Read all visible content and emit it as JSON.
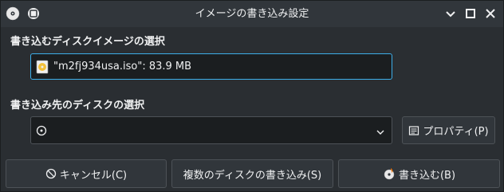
{
  "window": {
    "title": "イメージの書き込み設定"
  },
  "titlebar": {
    "app_icon": "disc-burn-icon",
    "pin_icon": "keep-above-icon",
    "minimize_icon": "minimize-icon",
    "maximize_icon": "maximize-icon",
    "close_icon": "close-icon"
  },
  "source": {
    "heading": "書き込むディスクイメージの選択",
    "file_label": "\"m2fj934usa.iso\": 83.9 MB",
    "file_icon": "iso-image-icon"
  },
  "target": {
    "heading": "書き込み先のディスクの選択",
    "selected_icon": "optical-drive-icon",
    "selected_value": "",
    "properties_label": "プロパティ(P)",
    "properties_icon": "properties-icon"
  },
  "actions": {
    "cancel_label": "キャンセル(C)",
    "cancel_icon": "cancel-icon",
    "multi_label": "複数のディスクの書き込み(S)",
    "burn_label": "書き込む(B)",
    "burn_icon": "burn-icon"
  },
  "colors": {
    "background": "#2a2e32",
    "field": "#1b1e20",
    "accent": "#3daee9",
    "button": "#31363b",
    "border": "#4d5257",
    "text": "#eff0f1"
  }
}
